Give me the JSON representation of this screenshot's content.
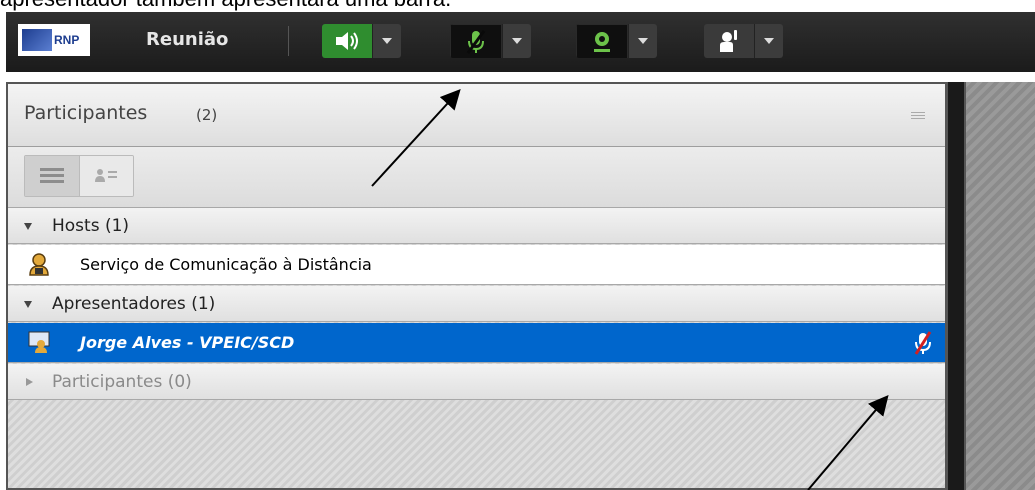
{
  "caption": "apresentador também apresentará uma barra.",
  "toolbar": {
    "logo_text": "RNP",
    "meeting_label": "Reunião",
    "buttons": [
      {
        "name": "speaker",
        "icon": "speaker-icon",
        "state": "on",
        "color": "#2f8d2f"
      },
      {
        "name": "microphone",
        "icon": "mic-muted-icon",
        "state": "muted",
        "color": "#0f0f0f"
      },
      {
        "name": "webcam",
        "icon": "webcam-icon",
        "state": "off",
        "color": "#0f0f0f"
      },
      {
        "name": "raise-hand",
        "icon": "raise-hand-icon",
        "state": "off",
        "color": "#3a3a3a"
      }
    ]
  },
  "panel": {
    "title": "Participantes",
    "count": "(2)",
    "groups": [
      {
        "label": "Hosts (1)",
        "expanded": true,
        "members": [
          {
            "name": "Serviço de Comunicação à Distância",
            "role_icon": "host-icon",
            "selected": false
          }
        ]
      },
      {
        "label": "Apresentadores (1)",
        "expanded": true,
        "members": [
          {
            "name": "Jorge Alves - VPEIC/SCD",
            "role_icon": "presenter-icon",
            "selected": true,
            "mic_icon": "mic-muted-icon"
          }
        ]
      },
      {
        "label": "Participantes (0)",
        "expanded": false,
        "members": []
      }
    ]
  },
  "colors": {
    "selection": "#0066cc",
    "toolbar": "#262626",
    "mic_muted": "#d32020"
  }
}
